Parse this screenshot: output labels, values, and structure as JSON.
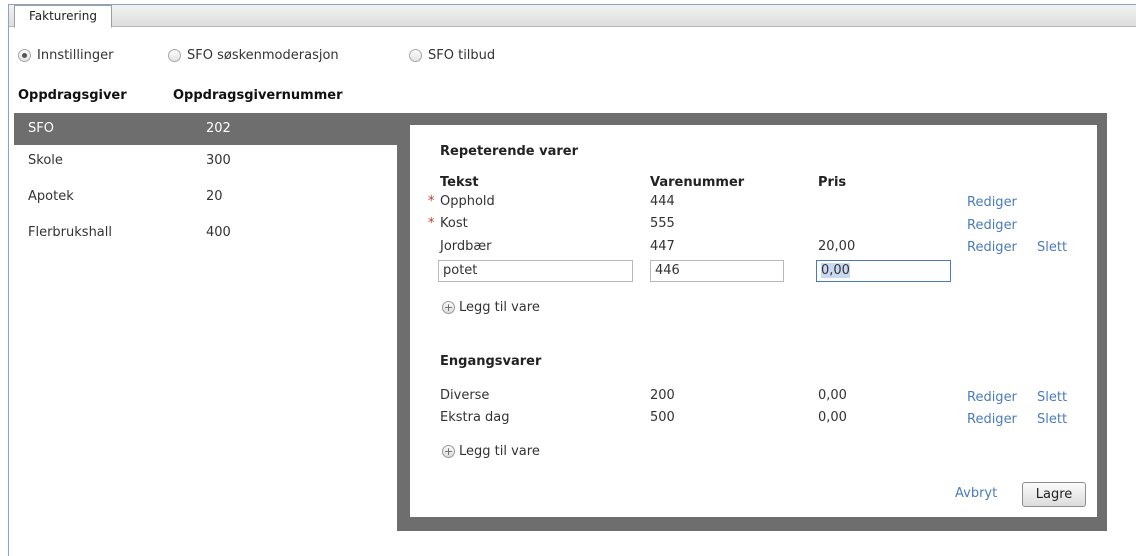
{
  "tab": {
    "label": "Fakturering"
  },
  "radios": [
    {
      "label": "Innstillinger",
      "selected": true
    },
    {
      "label": "SFO søskenmoderasjon",
      "selected": false
    },
    {
      "label": "SFO tilbud",
      "selected": false
    }
  ],
  "list_headers": {
    "name": "Oppdragsgiver",
    "number": "Oppdragsgivernummer"
  },
  "clients": [
    {
      "name": "SFO",
      "number": "202",
      "selected": true
    },
    {
      "name": "Skole",
      "number": "300"
    },
    {
      "name": "Apotek",
      "number": "20"
    },
    {
      "name": "Flerbrukshall",
      "number": "400"
    }
  ],
  "recurring": {
    "title": "Repeterende varer",
    "headers": {
      "text": "Tekst",
      "number": "Varenummer",
      "price": "Pris"
    },
    "rows": [
      {
        "required": "*",
        "text": "Opphold",
        "number": "444",
        "price": "",
        "edit": "Rediger"
      },
      {
        "required": "*",
        "text": "Kost",
        "number": "555",
        "price": "",
        "edit": "Rediger"
      },
      {
        "text": "Jordbær",
        "number": "447",
        "price": "20,00",
        "edit": "Rediger",
        "delete": "Slett"
      }
    ],
    "new_row": {
      "text": "potet",
      "number": "446",
      "price": "0,00"
    },
    "add_label": "Legg til vare"
  },
  "onetime": {
    "title": "Engangsvarer",
    "rows": [
      {
        "text": "Diverse",
        "number": "200",
        "price": "0,00",
        "edit": "Rediger",
        "delete": "Slett"
      },
      {
        "text": "Ekstra dag",
        "number": "500",
        "price": "0,00",
        "edit": "Rediger",
        "delete": "Slett"
      }
    ],
    "add_label": "Legg til vare"
  },
  "actions": {
    "cancel": "Avbryt",
    "save": "Lagre"
  },
  "colors": {
    "selected_row": "#6e6e6e",
    "link": "#4a7bbd",
    "required": "#c0392b"
  }
}
